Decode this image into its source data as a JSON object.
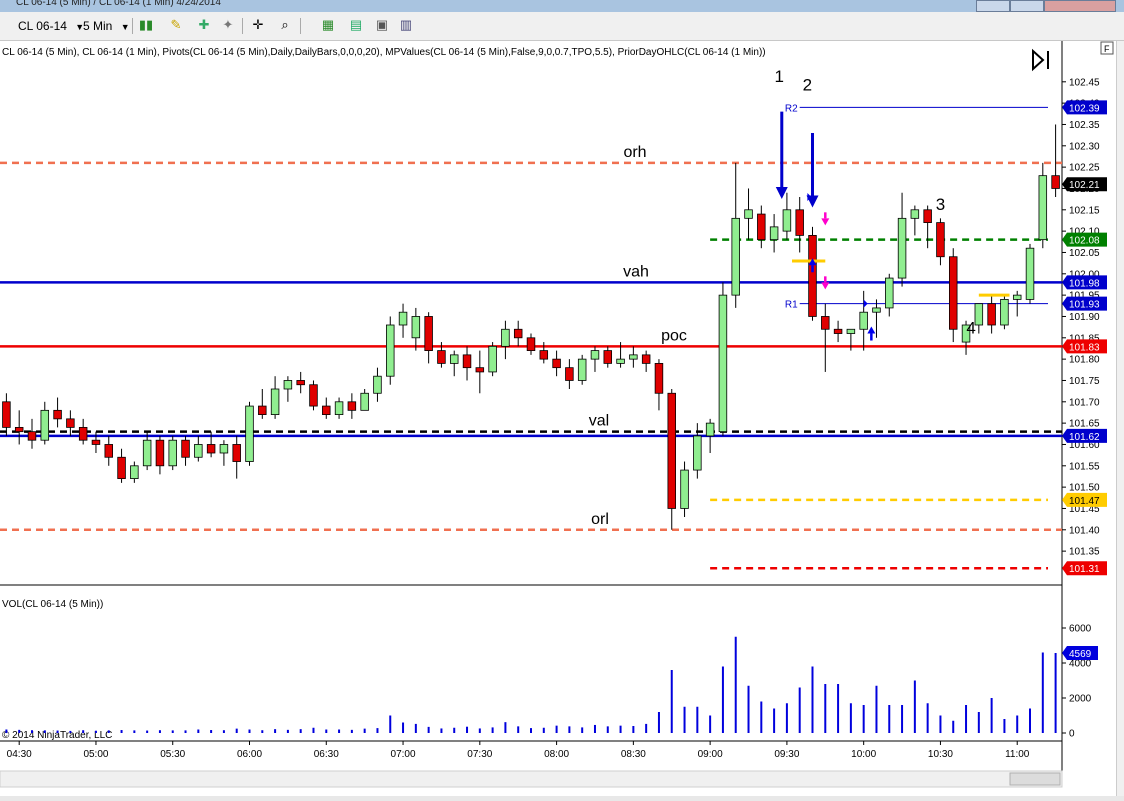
{
  "window": {
    "title": "CL 06-14 (5 Min) / CL 06-14 (1 Min)  4/24/2014"
  },
  "toolbar": {
    "instrument": "CL 06-14",
    "interval": "5 Min"
  },
  "chart_data": [
    {
      "type": "candlestick",
      "indicator_header": "CL 06-14 (5 Min), CL 06-14 (1 Min), Pivots(CL 06-14 (5 Min),Daily,DailyBars,0,0,0,20), MPValues(CL 06-14 (5 Min),False,9,0,0.7,TPO,5.5), PriorDayOHLC(CL 06-14 (1 Min))",
      "y_ticks": [
        "102.45",
        "102.40",
        "102.35",
        "102.30",
        "102.25",
        "102.20",
        "102.15",
        "102.10",
        "102.05",
        "102.00",
        "101.95",
        "101.90",
        "101.85",
        "101.80",
        "101.75",
        "101.70",
        "101.65",
        "101.60",
        "101.55",
        "101.50",
        "101.45",
        "101.40",
        "101.35"
      ],
      "ylim": [
        101.28,
        102.48
      ],
      "x_ticks": [
        "04:30",
        "05:00",
        "05:30",
        "06:00",
        "06:30",
        "07:00",
        "07:30",
        "08:00",
        "08:30",
        "09:00",
        "09:30",
        "10:00",
        "10:30",
        "11:00"
      ],
      "x_tick_minutes": [
        270,
        300,
        330,
        360,
        390,
        420,
        450,
        480,
        510,
        540,
        570,
        600,
        630,
        660
      ],
      "xlim_minutes": [
        262.5,
        677.5
      ],
      "bar_minutes": 5,
      "first_bar_minute": 265,
      "bar_colors": {
        "up": "#90ee90",
        "down": "#e00000",
        "outline": "#000000"
      },
      "candles": [
        [
          101.7,
          101.72,
          101.62,
          101.64
        ],
        [
          101.64,
          101.68,
          101.6,
          101.63
        ],
        [
          101.63,
          101.66,
          101.59,
          101.61
        ],
        [
          101.61,
          101.7,
          101.6,
          101.68
        ],
        [
          101.68,
          101.71,
          101.64,
          101.66
        ],
        [
          101.66,
          101.68,
          101.62,
          101.64
        ],
        [
          101.64,
          101.66,
          101.6,
          101.61
        ],
        [
          101.61,
          101.63,
          101.58,
          101.6
        ],
        [
          101.6,
          101.62,
          101.55,
          101.57
        ],
        [
          101.57,
          101.59,
          101.51,
          101.52
        ],
        [
          101.52,
          101.56,
          101.51,
          101.55
        ],
        [
          101.55,
          101.63,
          101.54,
          101.61
        ],
        [
          101.61,
          101.62,
          101.53,
          101.55
        ],
        [
          101.55,
          101.62,
          101.54,
          101.61
        ],
        [
          101.61,
          101.62,
          101.55,
          101.57
        ],
        [
          101.57,
          101.62,
          101.56,
          101.6
        ],
        [
          101.6,
          101.63,
          101.57,
          101.58
        ],
        [
          101.58,
          101.61,
          101.55,
          101.6
        ],
        [
          101.6,
          101.62,
          101.52,
          101.56
        ],
        [
          101.56,
          101.7,
          101.55,
          101.69
        ],
        [
          101.69,
          101.73,
          101.66,
          101.67
        ],
        [
          101.67,
          101.76,
          101.66,
          101.73
        ],
        [
          101.73,
          101.76,
          101.7,
          101.75
        ],
        [
          101.75,
          101.77,
          101.72,
          101.74
        ],
        [
          101.74,
          101.75,
          101.68,
          101.69
        ],
        [
          101.69,
          101.71,
          101.66,
          101.67
        ],
        [
          101.67,
          101.71,
          101.66,
          101.7
        ],
        [
          101.7,
          101.72,
          101.66,
          101.68
        ],
        [
          101.68,
          101.73,
          101.68,
          101.72
        ],
        [
          101.72,
          101.78,
          101.7,
          101.76
        ],
        [
          101.76,
          101.9,
          101.74,
          101.88
        ],
        [
          101.88,
          101.93,
          101.85,
          101.91
        ],
        [
          101.85,
          101.92,
          101.82,
          101.9
        ],
        [
          101.9,
          101.91,
          101.79,
          101.82
        ],
        [
          101.82,
          101.84,
          101.78,
          101.79
        ],
        [
          101.79,
          101.82,
          101.76,
          101.81
        ],
        [
          101.81,
          101.83,
          101.75,
          101.78
        ],
        [
          101.78,
          101.82,
          101.72,
          101.77
        ],
        [
          101.77,
          101.84,
          101.76,
          101.83
        ],
        [
          101.83,
          101.89,
          101.8,
          101.87
        ],
        [
          101.87,
          101.89,
          101.83,
          101.85
        ],
        [
          101.85,
          101.86,
          101.81,
          101.82
        ],
        [
          101.82,
          101.84,
          101.79,
          101.8
        ],
        [
          101.8,
          101.82,
          101.76,
          101.78
        ],
        [
          101.78,
          101.8,
          101.73,
          101.75
        ],
        [
          101.75,
          101.81,
          101.74,
          101.8
        ],
        [
          101.8,
          101.83,
          101.77,
          101.82
        ],
        [
          101.82,
          101.83,
          101.78,
          101.79
        ],
        [
          101.79,
          101.84,
          101.78,
          101.8
        ],
        [
          101.8,
          101.83,
          101.78,
          101.81
        ],
        [
          101.81,
          101.82,
          101.77,
          101.79
        ],
        [
          101.79,
          101.8,
          101.68,
          101.72
        ],
        [
          101.72,
          101.73,
          101.4,
          101.45
        ],
        [
          101.45,
          101.56,
          101.43,
          101.54
        ],
        [
          101.54,
          101.65,
          101.52,
          101.62
        ],
        [
          101.62,
          101.66,
          101.58,
          101.65
        ],
        [
          101.63,
          101.98,
          101.62,
          101.95
        ],
        [
          101.95,
          102.26,
          101.92,
          102.13
        ],
        [
          102.13,
          102.2,
          102.08,
          102.15
        ],
        [
          102.14,
          102.16,
          102.06,
          102.08
        ],
        [
          102.08,
          102.14,
          102.05,
          102.11
        ],
        [
          102.1,
          102.19,
          102.08,
          102.15
        ],
        [
          102.15,
          102.18,
          102.05,
          102.09
        ],
        [
          102.09,
          102.11,
          101.89,
          101.9
        ],
        [
          101.9,
          101.93,
          101.77,
          101.87
        ],
        [
          101.87,
          101.89,
          101.84,
          101.86
        ],
        [
          101.86,
          101.87,
          101.82,
          101.87
        ],
        [
          101.87,
          101.96,
          101.82,
          101.91
        ],
        [
          101.91,
          101.94,
          101.85,
          101.92
        ],
        [
          101.92,
          102.0,
          101.9,
          101.99
        ],
        [
          101.99,
          102.19,
          101.97,
          102.13
        ],
        [
          102.13,
          102.16,
          102.09,
          102.15
        ],
        [
          102.15,
          102.16,
          102.06,
          102.12
        ],
        [
          102.12,
          102.13,
          102.02,
          102.04
        ],
        [
          102.04,
          102.06,
          101.84,
          101.87
        ],
        [
          101.84,
          101.89,
          101.81,
          101.88
        ],
        [
          101.88,
          101.92,
          101.86,
          101.93
        ],
        [
          101.93,
          101.95,
          101.86,
          101.88
        ],
        [
          101.88,
          101.95,
          101.87,
          101.94
        ],
        [
          101.94,
          101.96,
          101.9,
          101.95
        ],
        [
          101.94,
          102.07,
          101.93,
          102.06
        ],
        [
          102.08,
          102.26,
          102.06,
          102.23
        ],
        [
          102.23,
          102.35,
          102.18,
          102.2
        ]
      ],
      "levels": [
        {
          "label": "orh",
          "value": 102.26,
          "color": "#f07050",
          "style": "dashed"
        },
        {
          "label": "vah",
          "value": 101.98,
          "color": "#0000cc",
          "style": "solid"
        },
        {
          "label": "poc",
          "value": 101.83,
          "color": "#ee0000",
          "style": "solid"
        },
        {
          "label": "val",
          "value": 101.63,
          "color": "#000000",
          "style": "dashed"
        },
        {
          "label": "",
          "value": 101.62,
          "color": "#0000cc",
          "style": "solid"
        },
        {
          "label": "orl",
          "value": 101.4,
          "color": "#f07050",
          "style": "dashed"
        },
        {
          "label": "",
          "value": 102.08,
          "color": "#008000",
          "style": "dashed",
          "from_minute": 540
        },
        {
          "label": "",
          "value": 101.47,
          "color": "#ffcc00",
          "style": "dashed",
          "from_minute": 540
        },
        {
          "label": "",
          "value": 101.31,
          "color": "#ee0000",
          "style": "dashed",
          "from_minute": 540
        },
        {
          "label": "R2",
          "value": 102.39,
          "color": "#0000cc",
          "style": "thin",
          "from_minute": 575
        },
        {
          "label": "R1",
          "value": 101.93,
          "color": "#0000cc",
          "style": "thin",
          "from_minute": 575
        }
      ],
      "price_tags": [
        {
          "text": "102.39",
          "value": 102.39,
          "bg": "#0000cc",
          "fg": "#ffffff"
        },
        {
          "text": "102.21",
          "value": 102.21,
          "bg": "#000000",
          "fg": "#ffffff"
        },
        {
          "text": "102.08",
          "value": 102.08,
          "bg": "#008000",
          "fg": "#ffffff"
        },
        {
          "text": "101.98",
          "value": 101.98,
          "bg": "#0000cc",
          "fg": "#ffffff"
        },
        {
          "text": "101.93",
          "value": 101.93,
          "bg": "#0000cc",
          "fg": "#ffffff"
        },
        {
          "text": "101.83",
          "value": 101.83,
          "bg": "#ee0000",
          "fg": "#ffffff"
        },
        {
          "text": "101.62",
          "value": 101.62,
          "bg": "#0000cc",
          "fg": "#ffffff"
        },
        {
          "text": "101.47",
          "value": 101.47,
          "bg": "#ffcc00",
          "fg": "#000000"
        },
        {
          "text": "101.31",
          "value": 101.31,
          "bg": "#ee0000",
          "fg": "#ffffff"
        }
      ],
      "annotations": [
        {
          "text": "1",
          "minute": 567,
          "value": 102.45
        },
        {
          "text": "2",
          "minute": 578,
          "value": 102.43
        },
        {
          "text": "3",
          "minute": 630,
          "value": 102.15
        },
        {
          "text": "4",
          "minute": 642,
          "value": 101.86
        }
      ]
    },
    {
      "type": "bar",
      "title": "VOL(CL 06-14 (5 Min))",
      "y_ticks": [
        "6000",
        "4000",
        "2000",
        "0"
      ],
      "ylim": [
        0,
        7200
      ],
      "last_value": "4569",
      "bar_color": "#0000dd",
      "values": [
        200,
        180,
        160,
        150,
        140,
        120,
        160,
        130,
        150,
        170,
        150,
        140,
        160,
        150,
        150,
        200,
        170,
        160,
        250,
        200,
        160,
        220,
        180,
        220,
        300,
        200,
        200,
        180,
        250,
        280,
        1000,
        600,
        520,
        350,
        260,
        300,
        360,
        260,
        320,
        620,
        380,
        280,
        300,
        420,
        380,
        320,
        460,
        380,
        420,
        400,
        520,
        1200,
        3600,
        1500,
        1500,
        1000,
        3800,
        5500,
        2700,
        1800,
        1400,
        1700,
        2600,
        3800,
        2800,
        2800,
        1700,
        1600,
        2700,
        1600,
        1600,
        3000,
        1700,
        1000,
        700,
        1600,
        1200,
        2000,
        800,
        1000,
        1400,
        4600,
        4569
      ]
    }
  ],
  "copyright": "© 2014 NinjaTrader, LLC",
  "axis_corner": "F"
}
